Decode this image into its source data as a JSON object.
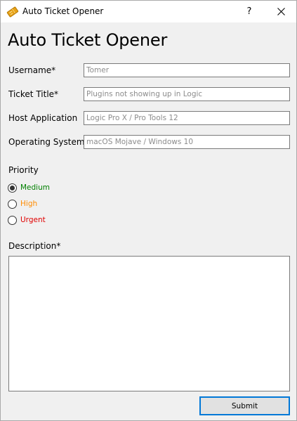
{
  "window": {
    "title": "Auto Ticket Opener",
    "help_label": "?"
  },
  "heading": "Auto Ticket Opener",
  "form": {
    "username": {
      "label": "Username*",
      "placeholder": "Tomer"
    },
    "ticket_title": {
      "label": "Ticket Title*",
      "placeholder": "Plugins not showing up in Logic"
    },
    "host_application": {
      "label": "Host Application",
      "placeholder": "Logic Pro X / Pro Tools 12"
    },
    "operating_system": {
      "label": "Operating System",
      "placeholder": "macOS Mojave / Windows 10"
    }
  },
  "priority": {
    "label": "Priority",
    "selected": "Medium",
    "options": [
      {
        "label": "Medium",
        "color": "#008000"
      },
      {
        "label": "High",
        "color": "#ff8c00"
      },
      {
        "label": "Urgent",
        "color": "#e00000"
      }
    ]
  },
  "description": {
    "label": "Description*"
  },
  "submit_label": "Submit",
  "icons": {
    "app": "ticket-icon",
    "close": "close-icon"
  },
  "colors": {
    "accent": "#0078d7",
    "field_border": "#7a7a7a",
    "placeholder": "#8c8c8c",
    "icon_gold": "#e8a317"
  }
}
